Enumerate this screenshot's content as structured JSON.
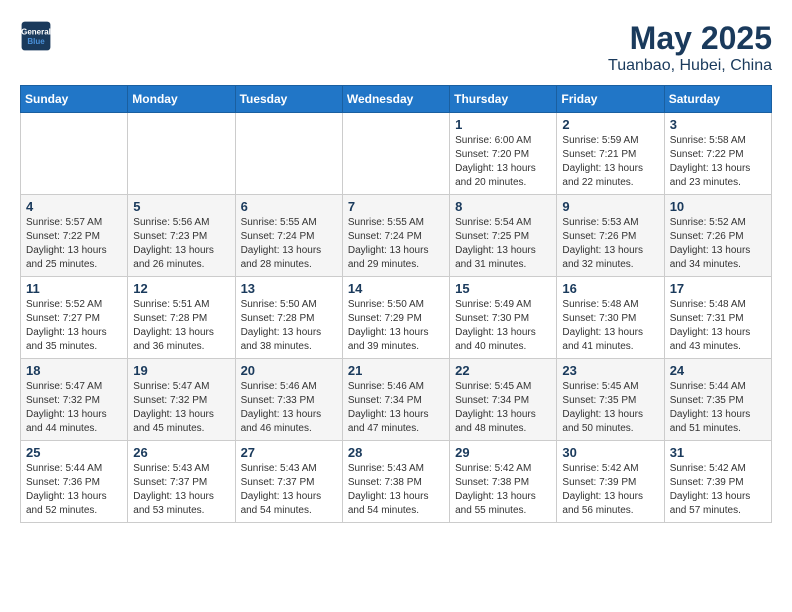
{
  "header": {
    "logo_line1": "General",
    "logo_line2": "Blue",
    "month": "May 2025",
    "location": "Tuanbao, Hubei, China"
  },
  "weekdays": [
    "Sunday",
    "Monday",
    "Tuesday",
    "Wednesday",
    "Thursday",
    "Friday",
    "Saturday"
  ],
  "weeks": [
    [
      {
        "day": "",
        "info": ""
      },
      {
        "day": "",
        "info": ""
      },
      {
        "day": "",
        "info": ""
      },
      {
        "day": "",
        "info": ""
      },
      {
        "day": "1",
        "info": "Sunrise: 6:00 AM\nSunset: 7:20 PM\nDaylight: 13 hours\nand 20 minutes."
      },
      {
        "day": "2",
        "info": "Sunrise: 5:59 AM\nSunset: 7:21 PM\nDaylight: 13 hours\nand 22 minutes."
      },
      {
        "day": "3",
        "info": "Sunrise: 5:58 AM\nSunset: 7:22 PM\nDaylight: 13 hours\nand 23 minutes."
      }
    ],
    [
      {
        "day": "4",
        "info": "Sunrise: 5:57 AM\nSunset: 7:22 PM\nDaylight: 13 hours\nand 25 minutes."
      },
      {
        "day": "5",
        "info": "Sunrise: 5:56 AM\nSunset: 7:23 PM\nDaylight: 13 hours\nand 26 minutes."
      },
      {
        "day": "6",
        "info": "Sunrise: 5:55 AM\nSunset: 7:24 PM\nDaylight: 13 hours\nand 28 minutes."
      },
      {
        "day": "7",
        "info": "Sunrise: 5:55 AM\nSunset: 7:24 PM\nDaylight: 13 hours\nand 29 minutes."
      },
      {
        "day": "8",
        "info": "Sunrise: 5:54 AM\nSunset: 7:25 PM\nDaylight: 13 hours\nand 31 minutes."
      },
      {
        "day": "9",
        "info": "Sunrise: 5:53 AM\nSunset: 7:26 PM\nDaylight: 13 hours\nand 32 minutes."
      },
      {
        "day": "10",
        "info": "Sunrise: 5:52 AM\nSunset: 7:26 PM\nDaylight: 13 hours\nand 34 minutes."
      }
    ],
    [
      {
        "day": "11",
        "info": "Sunrise: 5:52 AM\nSunset: 7:27 PM\nDaylight: 13 hours\nand 35 minutes."
      },
      {
        "day": "12",
        "info": "Sunrise: 5:51 AM\nSunset: 7:28 PM\nDaylight: 13 hours\nand 36 minutes."
      },
      {
        "day": "13",
        "info": "Sunrise: 5:50 AM\nSunset: 7:28 PM\nDaylight: 13 hours\nand 38 minutes."
      },
      {
        "day": "14",
        "info": "Sunrise: 5:50 AM\nSunset: 7:29 PM\nDaylight: 13 hours\nand 39 minutes."
      },
      {
        "day": "15",
        "info": "Sunrise: 5:49 AM\nSunset: 7:30 PM\nDaylight: 13 hours\nand 40 minutes."
      },
      {
        "day": "16",
        "info": "Sunrise: 5:48 AM\nSunset: 7:30 PM\nDaylight: 13 hours\nand 41 minutes."
      },
      {
        "day": "17",
        "info": "Sunrise: 5:48 AM\nSunset: 7:31 PM\nDaylight: 13 hours\nand 43 minutes."
      }
    ],
    [
      {
        "day": "18",
        "info": "Sunrise: 5:47 AM\nSunset: 7:32 PM\nDaylight: 13 hours\nand 44 minutes."
      },
      {
        "day": "19",
        "info": "Sunrise: 5:47 AM\nSunset: 7:32 PM\nDaylight: 13 hours\nand 45 minutes."
      },
      {
        "day": "20",
        "info": "Sunrise: 5:46 AM\nSunset: 7:33 PM\nDaylight: 13 hours\nand 46 minutes."
      },
      {
        "day": "21",
        "info": "Sunrise: 5:46 AM\nSunset: 7:34 PM\nDaylight: 13 hours\nand 47 minutes."
      },
      {
        "day": "22",
        "info": "Sunrise: 5:45 AM\nSunset: 7:34 PM\nDaylight: 13 hours\nand 48 minutes."
      },
      {
        "day": "23",
        "info": "Sunrise: 5:45 AM\nSunset: 7:35 PM\nDaylight: 13 hours\nand 50 minutes."
      },
      {
        "day": "24",
        "info": "Sunrise: 5:44 AM\nSunset: 7:35 PM\nDaylight: 13 hours\nand 51 minutes."
      }
    ],
    [
      {
        "day": "25",
        "info": "Sunrise: 5:44 AM\nSunset: 7:36 PM\nDaylight: 13 hours\nand 52 minutes."
      },
      {
        "day": "26",
        "info": "Sunrise: 5:43 AM\nSunset: 7:37 PM\nDaylight: 13 hours\nand 53 minutes."
      },
      {
        "day": "27",
        "info": "Sunrise: 5:43 AM\nSunset: 7:37 PM\nDaylight: 13 hours\nand 54 minutes."
      },
      {
        "day": "28",
        "info": "Sunrise: 5:43 AM\nSunset: 7:38 PM\nDaylight: 13 hours\nand 54 minutes."
      },
      {
        "day": "29",
        "info": "Sunrise: 5:42 AM\nSunset: 7:38 PM\nDaylight: 13 hours\nand 55 minutes."
      },
      {
        "day": "30",
        "info": "Sunrise: 5:42 AM\nSunset: 7:39 PM\nDaylight: 13 hours\nand 56 minutes."
      },
      {
        "day": "31",
        "info": "Sunrise: 5:42 AM\nSunset: 7:39 PM\nDaylight: 13 hours\nand 57 minutes."
      }
    ]
  ]
}
